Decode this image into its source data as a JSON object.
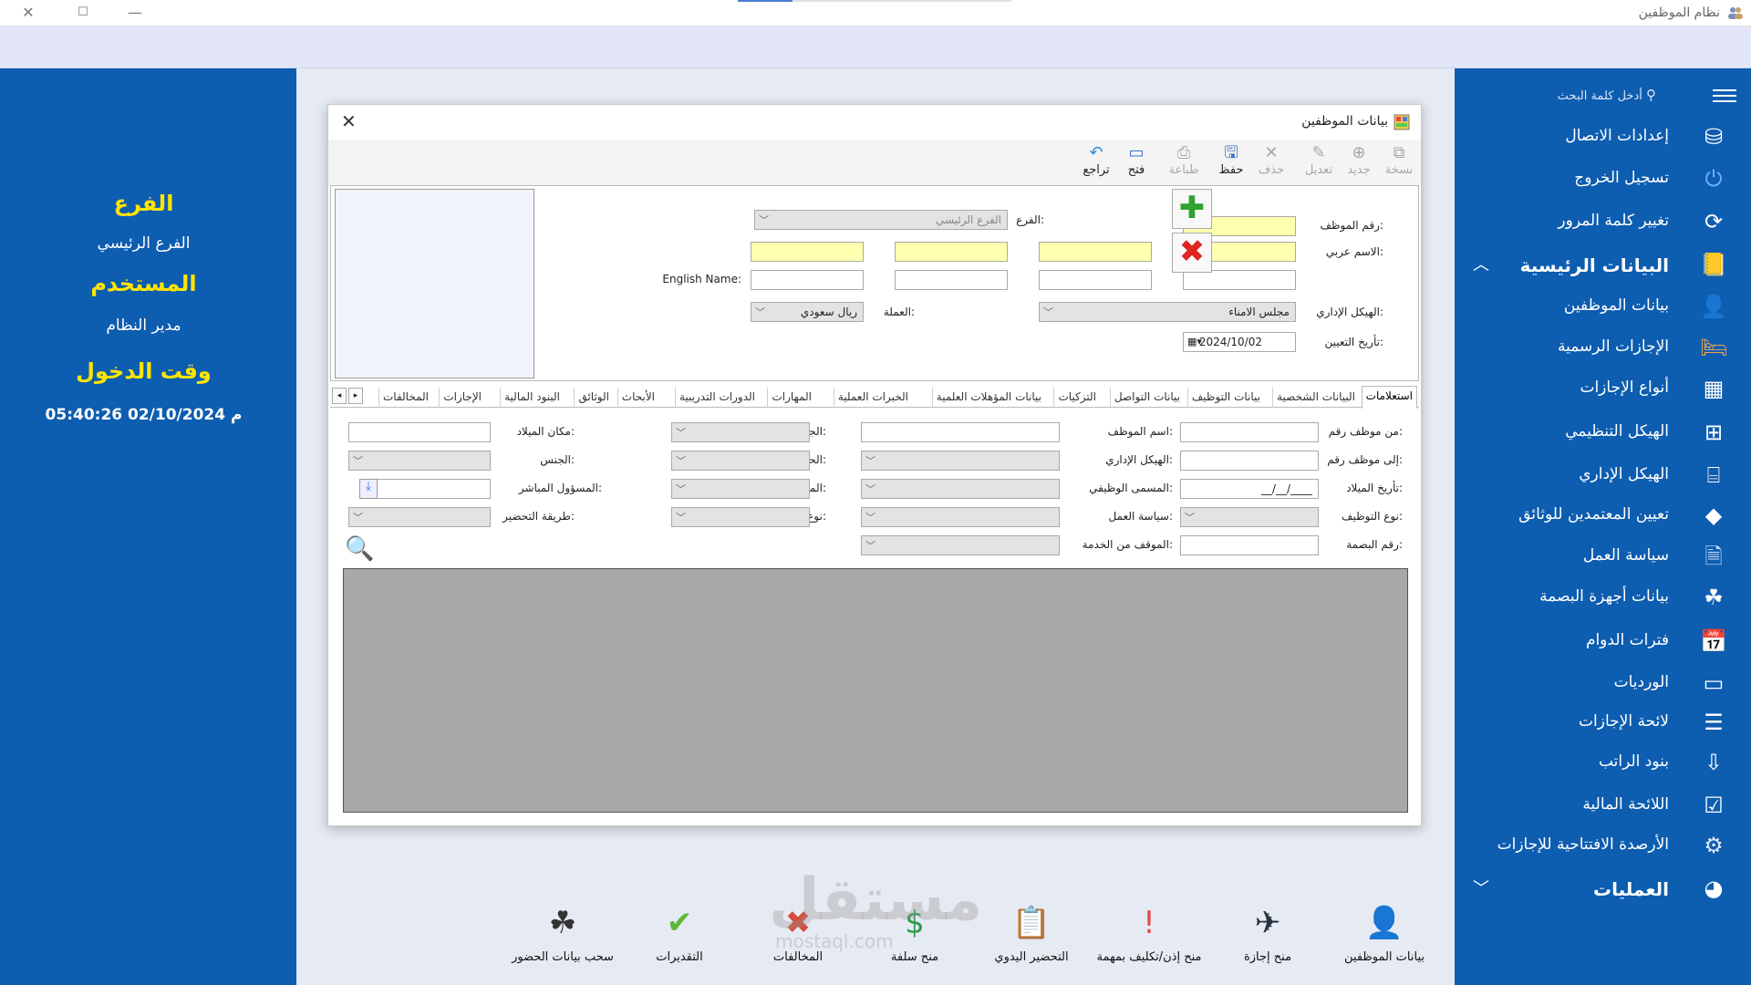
{
  "window": {
    "title": "نظام الموظفين"
  },
  "left_panel": {
    "branch_label": "الفرع",
    "branch_value": "الفرع الرئيسي",
    "user_label": "المستخدم",
    "user_value": "مدير النظام",
    "login_label": "وقت الدخول",
    "login_value": "05:40:26 02/10/2024 م"
  },
  "sidebar": {
    "search_placeholder": "أدخل كلمة البحث",
    "items": [
      {
        "label": "إعدادات الاتصال",
        "icon": "database-icon"
      },
      {
        "label": "تسجيل الخروج",
        "icon": "logout-icon"
      },
      {
        "label": "تغيير كلمة المرور",
        "icon": "refresh-icon"
      },
      {
        "label": "البيانات الرئيسية",
        "icon": "book-info-icon",
        "section": true
      },
      {
        "label": "بيانات الموظفين",
        "icon": "user-icon"
      },
      {
        "label": "الإجازات الرسمية",
        "icon": "bed-icon"
      },
      {
        "label": "أنواع الإجازات",
        "icon": "grid-icon"
      },
      {
        "label": "الهيكل التنظيمي",
        "icon": "org-chart-icon"
      },
      {
        "label": "الهيكل الإداري",
        "icon": "admin-structure-icon"
      },
      {
        "label": "تعيين المعتمدين للوثائق",
        "icon": "shapes-icon"
      },
      {
        "label": "سياسة العمل",
        "icon": "policy-icon"
      },
      {
        "label": "بيانات أجهزة البصمة",
        "icon": "fingerprint-icon"
      },
      {
        "label": "فترات الدوام",
        "icon": "calendar-clock-icon"
      },
      {
        "label": "الورديات",
        "icon": "card-icon"
      },
      {
        "label": "لائحة الإجازات",
        "icon": "list-icon"
      },
      {
        "label": "بنود الراتب",
        "icon": "salary-items-icon"
      },
      {
        "label": "اللائحة المالية",
        "icon": "checklist-icon"
      },
      {
        "label": "الأرصدة الافتتاحية للإجازات",
        "icon": "settings-window-icon"
      },
      {
        "label": "العمليات",
        "icon": "operations-icon",
        "section": true
      }
    ]
  },
  "dialog": {
    "title": "بيانات الموظفين",
    "toolbar": {
      "copy": "نسخة",
      "new": "جديد",
      "edit": "تعديل",
      "delete": "حذف",
      "save": "حفظ",
      "print": "طباعة",
      "open": "فتح",
      "undo": "تراجع"
    },
    "header": {
      "emp_no_label": "رقم الموظف:",
      "branch_label": "الفرع:",
      "branch_value": "الفرع الرئيسي",
      "arabic_name_label": "الاسم عربي:",
      "english_name_label": "English Name:",
      "admin_structure_label": "الهيكل الإداري:",
      "admin_structure_value": "مجلس الامناء",
      "currency_label": "العملة:",
      "currency_value": "ريال سعودي",
      "hire_date_label": "تأريخ التعيين:",
      "hire_date_value": "2024/10/02"
    },
    "tabs": [
      "استعلامات",
      "البيانات الشخصية",
      "بيانات التوظيف",
      "بيانات التواصل",
      "التزكيات",
      "بيانات المؤهلات العلمية",
      "الخبرات العملية",
      "المهارات",
      "الدورات التدريبية",
      "الأبحاث",
      "الوثائق",
      "البنود المالية",
      "الإجازات",
      "المخالفات"
    ],
    "query": {
      "from_emp": "من موظف رقم:",
      "to_emp": "إلى موظف رقم:",
      "birth_date": "تأريخ الميلاد:",
      "birth_date_value": "__/__/____",
      "employment_type": "نوع التوظيف:",
      "fingerprint_no": "رقم البصمة:",
      "emp_name": "اسم الموظف:",
      "admin_structure": "الهيكل الإداري:",
      "job_title": "المسمى الوظيفي:",
      "work_policy": "سياسة العمل:",
      "service_stop": "الموقف من الخدمة:",
      "nationality": "الجنسية:",
      "marital_status": "الحالة الاجتماعية:",
      "admin_title": "المسمى الإداري:",
      "contract_type": "نوع العقد:",
      "birth_place": "مكان الميلاد:",
      "gender": "الجنس:",
      "direct_manager": "المسؤول المباشر:",
      "attendance_method": "طريقة التحضير:"
    }
  },
  "bottom_bar": [
    {
      "label": "بيانات الموظفين",
      "icon": "user-icon"
    },
    {
      "label": "منح إجازة",
      "icon": "airplane-icon"
    },
    {
      "label": "منح إذن/تكليف بمهمة",
      "icon": "calendar-alert-icon"
    },
    {
      "label": "التحضير اليدوي",
      "icon": "clipboard-icon"
    },
    {
      "label": "منح سلفة",
      "icon": "money-icon"
    },
    {
      "label": "المخالفات",
      "icon": "violation-icon"
    },
    {
      "label": "التقديرات",
      "icon": "check-icon"
    },
    {
      "label": "سحب بيانات الحضور",
      "icon": "fingerprint-icon"
    }
  ],
  "watermark": {
    "text": "مستقل",
    "sub": "mostaql.com"
  }
}
